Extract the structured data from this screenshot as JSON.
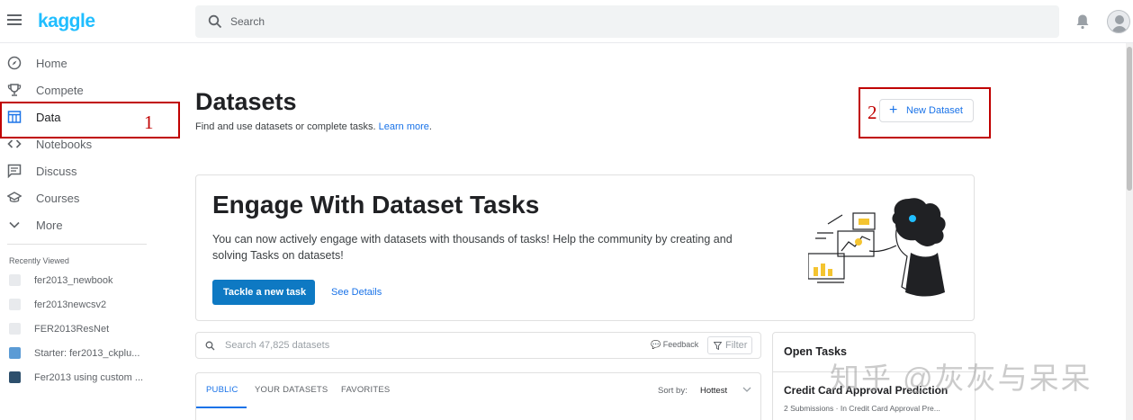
{
  "header": {
    "logo_text": "kaggle",
    "search_placeholder": "Search",
    "brand_color": "#20beff"
  },
  "sidebar": {
    "items": [
      {
        "label": "Home",
        "icon": "compass-icon"
      },
      {
        "label": "Compete",
        "icon": "trophy-icon"
      },
      {
        "label": "Data",
        "icon": "table-icon",
        "active": true
      },
      {
        "label": "Notebooks",
        "icon": "code-icon"
      },
      {
        "label": "Discuss",
        "icon": "comment-icon"
      },
      {
        "label": "Courses",
        "icon": "school-icon"
      },
      {
        "label": "More",
        "icon": "chevron-down-icon"
      }
    ],
    "recently_viewed_title": "Recently Viewed",
    "recently_viewed": [
      "fer2013_newbook",
      "fer2013newcsv2",
      "FER2013ResNet",
      "Starter: fer2013_ckplu...",
      "Fer2013 using custom ..."
    ]
  },
  "annotations": {
    "one": "1",
    "two": "2",
    "color": "#c00000"
  },
  "main": {
    "title": "Datasets",
    "subtitle": "Find and use datasets or complete tasks.",
    "learn_more": "Learn more",
    "subtitle_end": ".",
    "new_dataset_label": "New Dataset",
    "banner": {
      "heading": "Engage With Dataset Tasks",
      "body": "You can now actively engage with datasets with thousands of tasks! Help the community by creating and solving Tasks on datasets!",
      "primary_button": "Tackle a new task",
      "secondary_link": "See Details"
    },
    "dataset_search": {
      "placeholder": "Search 47,825 datasets",
      "feedback": "Feedback",
      "filter": "Filter"
    },
    "tabs": [
      {
        "label": "PUBLIC",
        "active": true
      },
      {
        "label": "YOUR DATASETS"
      },
      {
        "label": "FAVORITES"
      }
    ],
    "sort_label": "Sort by:",
    "sort_value": "Hottest",
    "open_tasks": {
      "title": "Open Tasks",
      "task_name": "Credit Card Approval Prediction",
      "task_meta": "2 Submissions · In Credit Card Approval Pre..."
    }
  },
  "watermark": "知乎 @灰灰与呆呆"
}
